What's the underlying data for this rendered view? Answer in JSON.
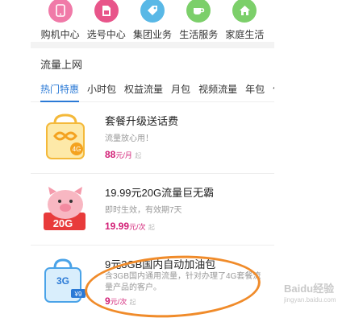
{
  "nav_grid": [
    {
      "label": "购机中心",
      "icon": "phone-icon",
      "color": "#f07aa8"
    },
    {
      "label": "选号中心",
      "icon": "sim-card-icon",
      "color": "#e8558a"
    },
    {
      "label": "集团业务",
      "icon": "tag-icon",
      "color": "#59b8e6"
    },
    {
      "label": "生活服务",
      "icon": "cup-icon",
      "color": "#7ccf6a"
    },
    {
      "label": "家庭生活",
      "icon": "home-icon",
      "color": "#7ccf6a"
    }
  ],
  "section": {
    "title": "流量上网"
  },
  "tabs": [
    "热门特惠",
    "小时包",
    "权益流量",
    "月包",
    "视频流量",
    "年包",
    "优"
  ],
  "cards": [
    {
      "title": "套餐升级送话费",
      "subtitle": "流量放心用！",
      "price": "88",
      "unit": "元/月",
      "qualifier": "起"
    },
    {
      "title": "19.99元20G流量巨无霸",
      "subtitle": "即时生效，有效期7天",
      "price": "19.99",
      "unit": "元/次",
      "qualifier": "起",
      "badge": "20G"
    },
    {
      "title": "9元3GB国内自动加油包",
      "subtitle": "含3GB国内通用流量，针对办理了4G套餐流量产品的客户。",
      "price": "9",
      "unit": "元/次",
      "qualifier": "起",
      "badge": "3G",
      "badge_price": "¥9"
    }
  ],
  "watermark": {
    "text": "Baidu经验",
    "sub": "jingyan.baidu.com"
  }
}
